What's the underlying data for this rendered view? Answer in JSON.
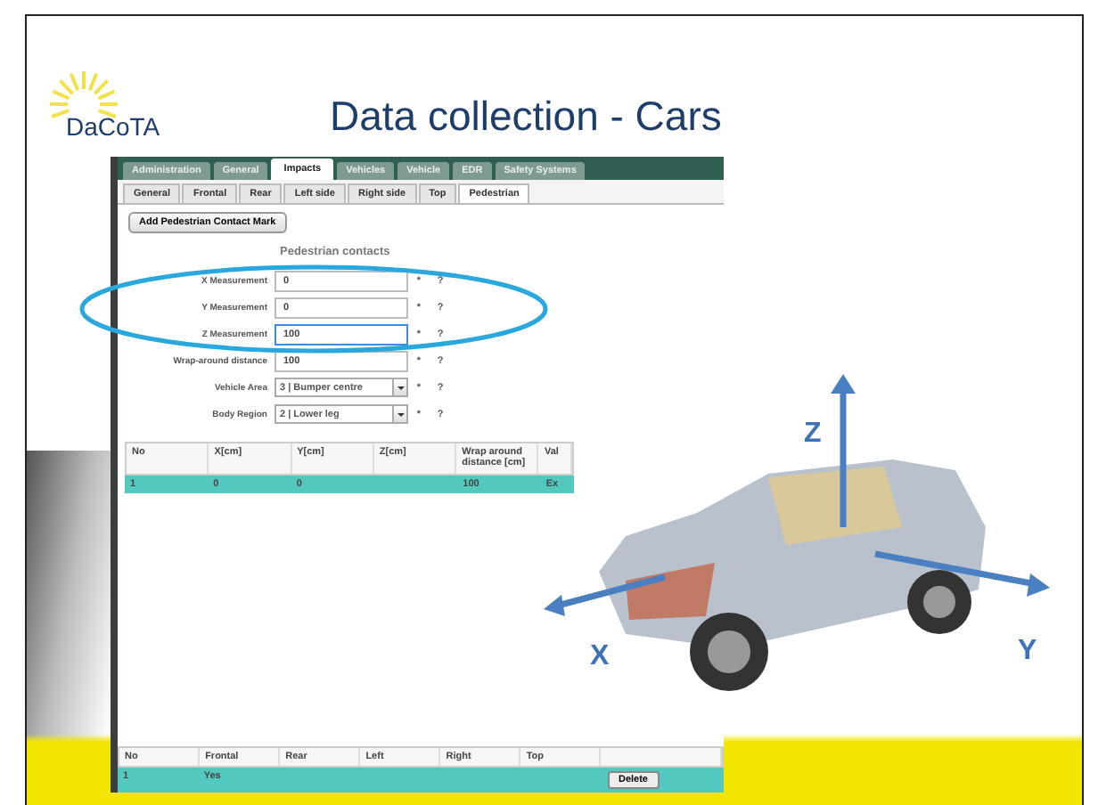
{
  "slide": {
    "logo": "DaCoTA",
    "title": "Data collection - Cars"
  },
  "app": {
    "main_tabs": [
      {
        "label": "Administration",
        "selected": false
      },
      {
        "label": "General",
        "selected": false
      },
      {
        "label": "Impacts",
        "selected": true
      },
      {
        "label": "Vehicles",
        "selected": false
      },
      {
        "label": "Vehicle",
        "selected": false
      },
      {
        "label": "EDR",
        "selected": false
      },
      {
        "label": "Safety Systems",
        "selected": false
      }
    ],
    "sub_tabs": [
      {
        "label": "General",
        "selected": false
      },
      {
        "label": "Frontal",
        "selected": false
      },
      {
        "label": "Rear",
        "selected": false
      },
      {
        "label": "Left side",
        "selected": false
      },
      {
        "label": "Right side",
        "selected": false
      },
      {
        "label": "Top",
        "selected": false
      },
      {
        "label": "Pedestrian",
        "selected": true
      }
    ],
    "add_button": "Add Pedestrian Contact Mark",
    "section_title": "Pedestrian contacts",
    "fields": [
      {
        "label": "X Measurement",
        "value": "0",
        "kind": "text",
        "focused": false,
        "required": "*",
        "help": "?"
      },
      {
        "label": "Y Measurement",
        "value": "0",
        "kind": "text",
        "focused": false,
        "required": "*",
        "help": "?"
      },
      {
        "label": "Z Measurement",
        "value": "100",
        "kind": "text",
        "focused": true,
        "required": "*",
        "help": "?"
      },
      {
        "label": "Wrap-around distance",
        "value": "100",
        "kind": "text",
        "focused": false,
        "required": "*",
        "help": "?"
      },
      {
        "label": "Vehicle Area",
        "value": "3 | Bumper centre",
        "kind": "select",
        "focused": false,
        "required": "*",
        "help": "?"
      },
      {
        "label": "Body Region",
        "value": "2 | Lower leg",
        "kind": "select",
        "focused": false,
        "required": "*",
        "help": "?"
      }
    ],
    "contacts_table": {
      "columns": [
        "No",
        "X[cm]",
        "Y[cm]",
        "Z[cm]",
        "Wrap around distance [cm]",
        "Val"
      ],
      "rows": [
        {
          "cells": [
            "1",
            "0",
            "0",
            null,
            "100",
            "Ex"
          ],
          "selected": true
        }
      ]
    },
    "impacts_table": {
      "columns": [
        "No",
        "Frontal",
        "Rear",
        "Left",
        "Right",
        "Top"
      ],
      "rows": [
        {
          "cells": [
            "1",
            "Yes",
            null,
            null,
            null,
            null
          ],
          "delete_button": "Delete",
          "selected": true
        }
      ]
    }
  },
  "car_figure": {
    "axes": [
      {
        "label": "X"
      },
      {
        "label": "Y"
      },
      {
        "label": "Z"
      }
    ]
  }
}
